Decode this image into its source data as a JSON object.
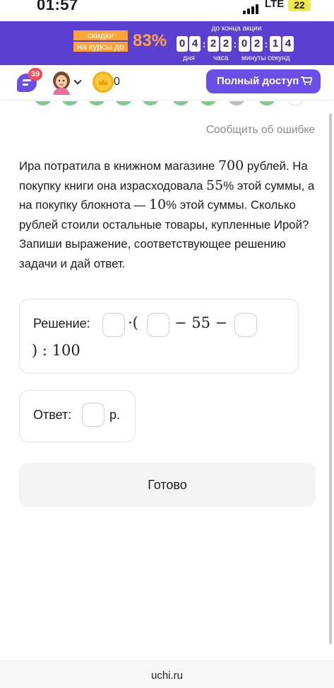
{
  "status_bar": {
    "time": "01:57",
    "network": "LTE",
    "battery": "22"
  },
  "promo": {
    "label_line1": "скидки",
    "label_line2": "на курсы до",
    "percent": "83%",
    "deadline_label": "до конца акции",
    "countdown": [
      "0",
      "4",
      "2",
      "2",
      "0",
      "2",
      "1",
      "4"
    ],
    "units": [
      "дня",
      "часа",
      "минуты",
      "секунд"
    ]
  },
  "header": {
    "chat_badge": "39",
    "coins": "0",
    "full_access_label": "Полный доступ",
    "colors": {
      "accent": "#6b4ee8",
      "badge": "#f44a5a",
      "promo_bg": "#5b3fd0",
      "promo_orange": "#ffa43a"
    }
  },
  "report_link": "Сообщить об ошибке",
  "task": {
    "part1": "Ира потратила в книжном магазине ",
    "n1": "700",
    "part2": " рублей. На покупку книги она израсходовала ",
    "n2": "55",
    "part3": "% этой суммы, а на покупку блокнота — ",
    "n3": "10",
    "part4": "% этой суммы. Сколько рублей стоили остальные товары, купленные Ирой? Запиши выражение, соответствующее решению задачи и дай ответ."
  },
  "solution": {
    "label": "Решение:",
    "op_open": "·(",
    "minus1": "− 55 −",
    "tail": ") : 100",
    "inputs": [
      "",
      "",
      ""
    ]
  },
  "answer": {
    "label": "Ответ:",
    "unit": "р.",
    "value": ""
  },
  "done_label": "Готово",
  "footer": "uchi.ru"
}
